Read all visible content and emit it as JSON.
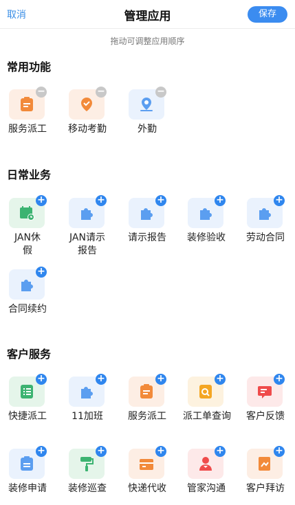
{
  "header": {
    "cancel": "取消",
    "title": "管理应用",
    "save": "保存"
  },
  "hint": "拖动可调整应用顺序",
  "sections": [
    {
      "title": "常用功能",
      "apps": [
        {
          "label": "服务派工",
          "icon": "clipboard-icon",
          "action": "remove"
        },
        {
          "label": "移动考勤",
          "icon": "location-check-icon",
          "action": "remove"
        },
        {
          "label": "外勤",
          "icon": "map-pin-icon",
          "action": "remove"
        }
      ]
    },
    {
      "title": "日常业务",
      "apps": [
        {
          "label": "JAN休假",
          "icon": "calendar-clock-icon",
          "action": "add"
        },
        {
          "label": "JAN请示报告",
          "icon": "puzzle-icon",
          "action": "add"
        },
        {
          "label": "请示报告",
          "icon": "puzzle-icon",
          "action": "add"
        },
        {
          "label": "装修验收",
          "icon": "puzzle-icon",
          "action": "add"
        },
        {
          "label": "劳动合同",
          "icon": "puzzle-icon",
          "action": "add"
        },
        {
          "label": "合同续约",
          "icon": "puzzle-icon",
          "action": "add"
        }
      ]
    },
    {
      "title": "客户服务",
      "apps": [
        {
          "label": "快捷派工",
          "icon": "list-icon",
          "action": "add"
        },
        {
          "label": "11加班",
          "icon": "puzzle-icon",
          "action": "add"
        },
        {
          "label": "服务派工",
          "icon": "clipboard-icon",
          "action": "add"
        },
        {
          "label": "派工单查询",
          "icon": "search-doc-icon",
          "action": "add"
        },
        {
          "label": "客户反馈",
          "icon": "feedback-icon",
          "action": "add"
        },
        {
          "label": "装修申请",
          "icon": "clipboard-check-icon",
          "action": "add"
        },
        {
          "label": "装修巡查",
          "icon": "paint-roller-icon",
          "action": "add"
        },
        {
          "label": "快递代收",
          "icon": "package-icon",
          "action": "add"
        },
        {
          "label": "管家沟通",
          "icon": "butler-icon",
          "action": "add"
        },
        {
          "label": "客户拜访",
          "icon": "visit-icon",
          "action": "add"
        }
      ]
    }
  ],
  "colors": {
    "accent": "#3b8cf0",
    "orange": "#f28a3a",
    "blue": "#5b9ef0",
    "green": "#3cb371",
    "yellow": "#f4a623",
    "red": "#ef4b4b"
  }
}
